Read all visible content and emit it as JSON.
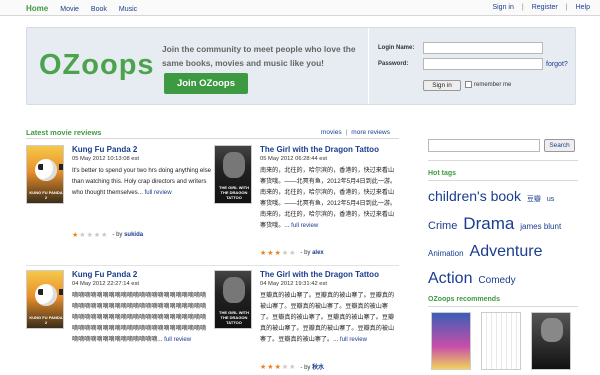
{
  "topnav": {
    "home": "Home",
    "links": [
      "Movie",
      "Book",
      "Music"
    ],
    "right": [
      "Sign in",
      "Register",
      "Help"
    ],
    "sep": "|"
  },
  "hero": {
    "logo": "OZoops",
    "pitch": "Join the community to meet people who love the same books, movies and music like you!",
    "join_label": "Join OZoops"
  },
  "login": {
    "name_label": "Login Name:",
    "password_label": "Password:",
    "forgot": "forgot?",
    "signin": "Sign in",
    "remember": "remember me"
  },
  "reviews_section": {
    "title": "Latest movie reviews",
    "links": [
      "movies",
      "more reviews"
    ],
    "sep": "|"
  },
  "reviews": [
    {
      "title": "Kung Fu Panda 2",
      "date": "05 May 2012 10:13:08 est",
      "text": "It's better to spend your two hrs doing anything else than watching this. Holy crap directors and writers who thought themselves...",
      "more": "full review",
      "rating": 1,
      "by": "- by",
      "author": "sukida",
      "poster_caption": "KUNG FU PANDA 2"
    },
    {
      "title": "The Girl with the Dragon Tattoo",
      "date": "05 May 2012 06:28:44 est",
      "text": "南来的，北往的，哈尔滨的，香港的，快过来看山寨货哦。——北冥有鱼，2012年5月4日到此一游。南来的，北往的，哈尔滨的，香港的，快过来看山寨货哦。——北冥有鱼，2012年5月4日到此一游。南来的，北往的，哈尔滨的，香港的，快过来看山寨货哦。...",
      "more": "full review",
      "rating": 3,
      "by": "- by",
      "author": "alex",
      "poster_caption": "THE GIRL WITH THE DRAGON TATTOO"
    },
    {
      "title": "Kung Fu Panda 2",
      "date": "04 May 2012 22:27:14 est",
      "text": "嘀嘀嘀嘀嘀嘀嘀嘀嘀嘀嘀嘀嘀嘀嘀嘀嘀嘀嘀嘀嘀嘀嘀嘀嘀嘀嘀嘀嘀嘀嘀嘀嘀嘀嘀嘀嘀嘀嘀嘀嘀嘀嘀嘀嘀嘀嘀嘀嘀嘀嘀嘀嘀嘀嘀嘀嘀嘀嘀嘀嘀嘀嘀嘀嘀嘀嘀嘀嘀嘀嘀嘀嘀嘀嘀嘀嘀嘀嘀嘀嘀嘀嘀嘀嘀嘀嘀嘀嘀嘀嘀嘀嘀嘀嘀嘀嘀嘀嘀嘀嘀嘀...",
      "more": "full review",
      "rating": 1,
      "by": "- by",
      "author": "sukida",
      "poster_caption": "KUNG FU PANDA 2"
    },
    {
      "title": "The Girl with the Dragon Tattoo",
      "date": "04 May 2012 19:31:42 est",
      "text": "豆瓣真的被山寨了。豆瓣真的被山寨了。豆瓣真的被山寨了。豆瓣真的被山寨了。豆瓣真的被山寨了。豆瓣真的被山寨了。豆瓣真的被山寨了。豆瓣真的被山寨了。豆瓣真的被山寨了。豆瓣真的被山寨了。豆瓣真的被山寨了。...",
      "more": "full review",
      "rating": 3,
      "by": "- by",
      "author": "秋水",
      "poster_caption": "THE GIRL WITH THE DRAGON TATTOO"
    }
  ],
  "search": {
    "button": "Search",
    "value": ""
  },
  "hot_tags": {
    "title": "Hot tags",
    "tags": [
      {
        "label": "children's book",
        "size": 14
      },
      {
        "label": "豆瓣",
        "size": 7
      },
      {
        "label": "us",
        "size": 7
      },
      {
        "label": "Crime",
        "size": 11
      },
      {
        "label": "Drama",
        "size": 17
      },
      {
        "label": "james blunt",
        "size": 8
      },
      {
        "label": "Animation",
        "size": 8
      },
      {
        "label": "Adventure",
        "size": 16
      },
      {
        "label": "Action",
        "size": 16
      },
      {
        "label": "Comedy",
        "size": 10
      }
    ]
  },
  "recommends": {
    "title": "OZoops recommends",
    "items": [
      "recommendation-1",
      "recommendation-2",
      "recommendation-3"
    ]
  },
  "colors": {
    "brand_green": "#4ca34d",
    "link_blue": "#1a3d8f",
    "star_on": "#f0801a",
    "star_off": "#c8c8c8"
  }
}
